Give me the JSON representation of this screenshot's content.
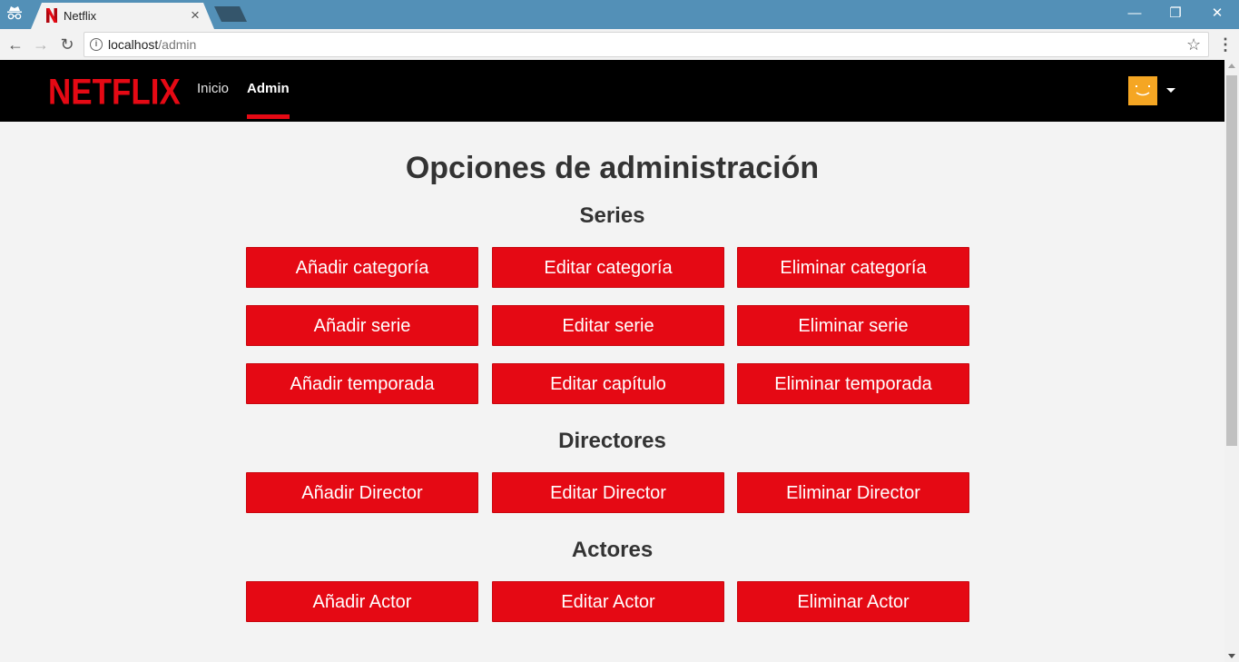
{
  "browser": {
    "tab_title": "Netflix",
    "url_host": "localhost",
    "url_path": "/admin",
    "icons": [
      "incognito-icon",
      "netflix-favicon",
      "close-icon",
      "minimize-icon",
      "restore-icon",
      "window-close-icon",
      "back-icon",
      "forward-icon",
      "reload-icon",
      "info-icon",
      "star-icon",
      "menu-icon"
    ]
  },
  "navbar": {
    "brand": "NETFLIX",
    "links": [
      {
        "label": "Inicio",
        "active": false
      },
      {
        "label": "Admin",
        "active": true
      }
    ],
    "accent_color": "#e50914",
    "avatar_color": "#f5a623"
  },
  "page": {
    "title": "Opciones de administración",
    "sections": [
      {
        "title": "Series",
        "buttons": [
          "Añadir categoría",
          "Editar categoría",
          "Eliminar categoría",
          "Añadir serie",
          "Editar serie",
          "Eliminar serie",
          "Añadir temporada",
          "Editar capítulo",
          "Eliminar temporada"
        ]
      },
      {
        "title": "Directores",
        "buttons": [
          "Añadir Director",
          "Editar Director",
          "Eliminar Director"
        ]
      },
      {
        "title": "Actores",
        "buttons": [
          "Añadir Actor",
          "Editar Actor",
          "Eliminar Actor"
        ]
      }
    ]
  }
}
